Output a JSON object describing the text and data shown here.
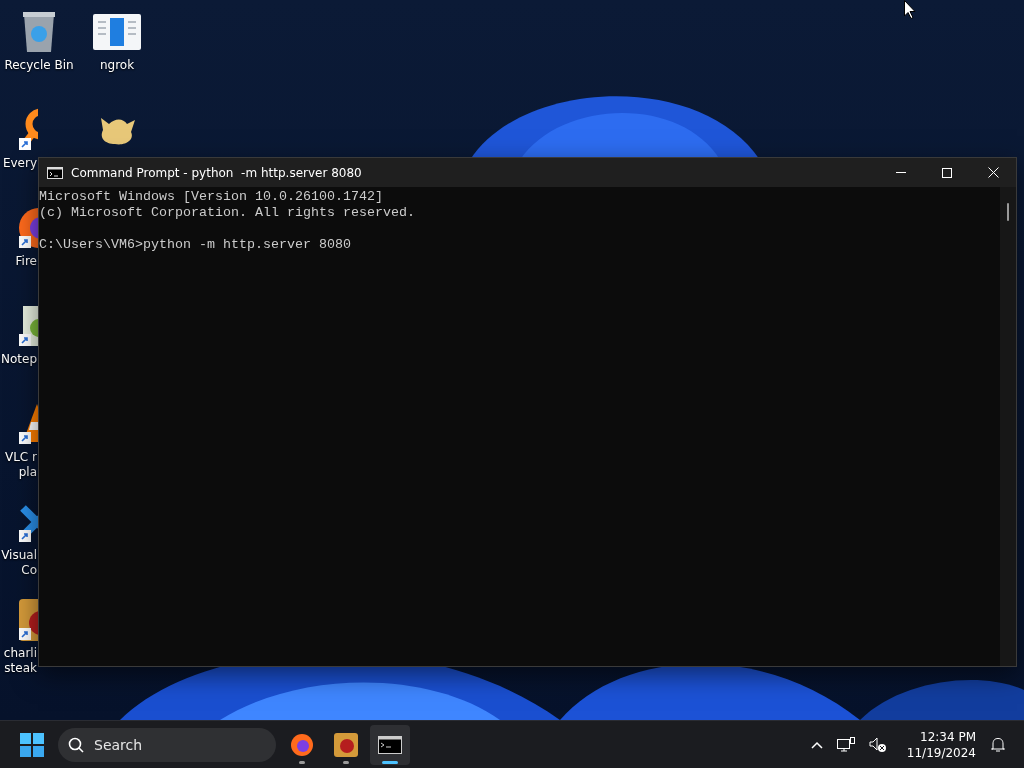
{
  "desktop": {
    "columns": [
      [
        {
          "lines": [
            "Recycle Bin"
          ]
        },
        {
          "lines": [
            "Every"
          ]
        },
        {
          "lines": [
            "Fire"
          ]
        },
        {
          "lines": [
            "Notep"
          ]
        },
        {
          "lines": [
            "VLC r",
            "pla"
          ]
        },
        {
          "lines": [
            "Visual",
            "Co"
          ]
        },
        {
          "lines": [
            "charli",
            "steak"
          ]
        }
      ],
      [
        {
          "lines": [
            "ngrok"
          ]
        }
      ]
    ]
  },
  "window": {
    "title": "Command Prompt - python  -m http.server 8080",
    "output": [
      [
        "Microsoft Windows [Version 10.0.26100.1742]",
        "(c) Microsoft Corporation. All rights reserved."
      ],
      [
        "C:\\Users\\VM6>python -m http.server 8080"
      ]
    ]
  },
  "taskbar": {
    "search": {
      "placeholder": "Search"
    },
    "apps": [
      {
        "selected": false
      },
      {
        "selected": false
      },
      {
        "selected": true
      }
    ],
    "clock": {
      "time": "12:34 PM",
      "date": "11/19/2024"
    }
  }
}
